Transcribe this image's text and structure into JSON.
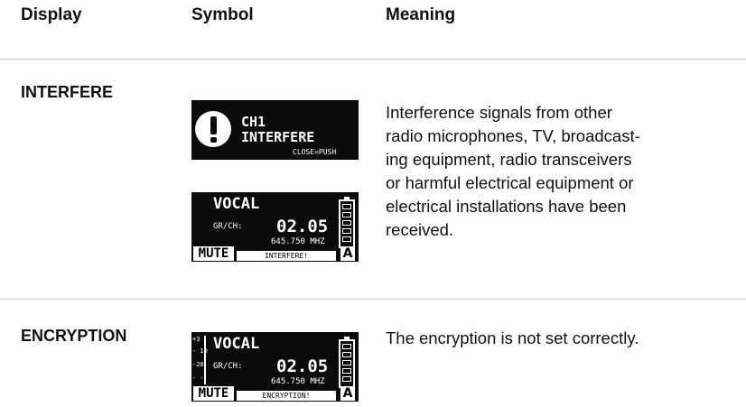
{
  "headers": {
    "display": "Display",
    "symbol": "Symbol",
    "meaning": "Meaning"
  },
  "rows": [
    {
      "display": "INTERFERE",
      "meaning_lines": [
        "Interference signals from other",
        "radio microphones, TV, broadcast-",
        "ing equipment, radio transceivers",
        "or harmful electrical equipment or",
        "electrical installations have been",
        "received."
      ],
      "alert_screen": {
        "line1": "CH1",
        "line2": "INTERFERE",
        "hint": "CLOSE=PUSH",
        "icon": "exclamation-icon"
      },
      "status_screen": {
        "name": "VOCAL",
        "grch_label": "GR/CH:",
        "grch_value": "02.05",
        "frequency": "645.750 MHZ",
        "mute": "MUTE",
        "status": "INTERFERE!",
        "channel": "A",
        "battery_icon": "battery-icon"
      }
    },
    {
      "display": "ENCRYPTION",
      "meaning_lines": [
        "The encryption is not set correctly."
      ],
      "status_screen": {
        "levels": [
          "+3",
          "- 10",
          "-20",
          "- -"
        ],
        "name": "VOCAL",
        "grch_label": "GR/CH:",
        "grch_value": "02.05",
        "frequency": "645.750 MHZ",
        "mute": "MUTE",
        "status": "ENCRYPTION!",
        "channel": "A",
        "battery_icon": "battery-icon"
      }
    }
  ]
}
